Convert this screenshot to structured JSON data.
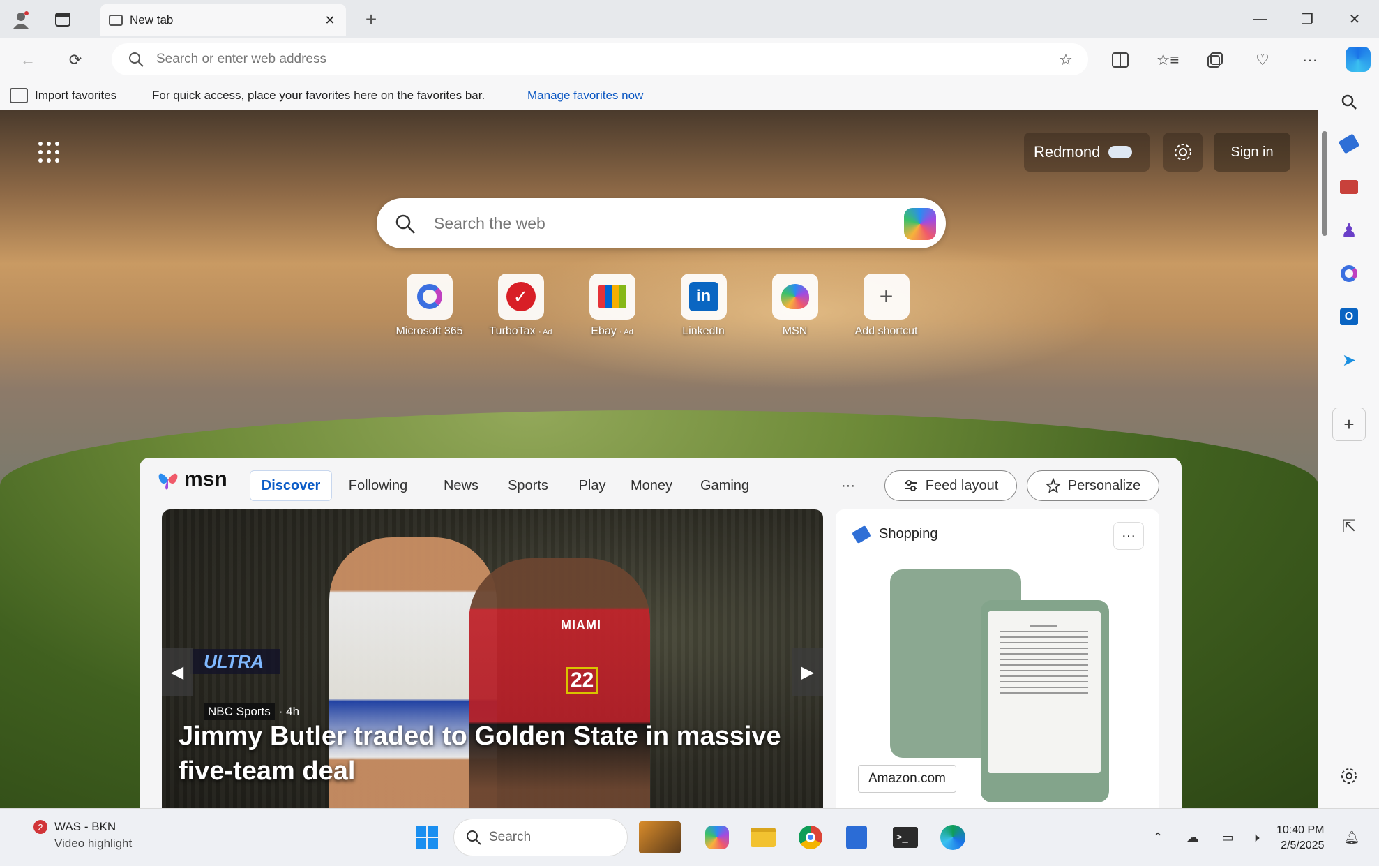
{
  "tabbar": {
    "tab_title": "New tab",
    "tab_close": "✕",
    "new_tab": "+",
    "window_controls": {
      "minimize": "—",
      "restore": "❐",
      "close": "✕"
    }
  },
  "toolbar": {
    "address_placeholder": "Search or enter web address",
    "more": "···"
  },
  "favorites_bar": {
    "import_label": "Import favorites",
    "message": "For quick access, place your favorites here on the favorites bar.",
    "manage_link": "Manage favorites now"
  },
  "ntp": {
    "weather_location": "Redmond",
    "sign_in": "Sign in",
    "search_placeholder": "Search the web",
    "shortcuts": [
      {
        "label": "Microsoft 365",
        "ad": "",
        "color": "#3b6fe0"
      },
      {
        "label": "TurboTax",
        "ad": "· Ad",
        "color": "#d81f26"
      },
      {
        "label": "Ebay",
        "ad": "· Ad",
        "color": "#1e5bb8"
      },
      {
        "label": "LinkedIn",
        "ad": "",
        "color": "#0a66c2"
      },
      {
        "label": "MSN",
        "ad": "",
        "color": "#8a3fd6"
      },
      {
        "label": "Add shortcut",
        "ad": "",
        "color": "#555555"
      }
    ]
  },
  "feed": {
    "logo": "msn",
    "tabs": {
      "discover": "Discover",
      "following": "Following",
      "news": "News",
      "sports": "Sports",
      "play": "Play",
      "money": "Money",
      "gaming": "Gaming",
      "more": "···"
    },
    "feed_layout": "Feed layout",
    "personalize": "Personalize",
    "hero": {
      "badge": "ULTRA",
      "jersey_text": "MIAMI",
      "jersey_number": "22",
      "source": "NBC Sports",
      "age": "· 4h",
      "title": "Jimmy Butler traded to Golden State in massive five-team deal"
    },
    "shopping": {
      "header": "Shopping",
      "more": "···",
      "store": "Amazon.com"
    }
  },
  "taskbar": {
    "notif_badge": "2",
    "notif_title": "WAS - BKN",
    "notif_sub": "Video highlight",
    "search_placeholder": "Search",
    "time": "10:40 PM",
    "date": "2/5/2025"
  },
  "colors": {
    "accent": "#0b5cc7",
    "edge_blue": "#1a73e8"
  }
}
